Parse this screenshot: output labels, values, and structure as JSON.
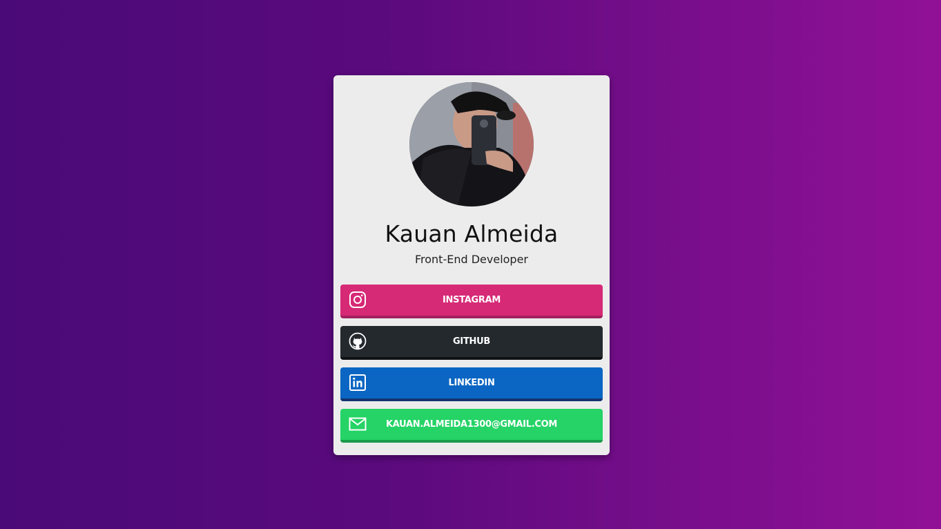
{
  "profile": {
    "name": "Kauan Almeida",
    "role": "Front-End Developer",
    "avatar_alt": "profile-photo"
  },
  "links": {
    "instagram": {
      "label": "INSTAGRAM",
      "icon": "instagram-icon",
      "color": "#d62976"
    },
    "github": {
      "label": "GITHUB",
      "icon": "github-icon",
      "color": "#24292e"
    },
    "linkedin": {
      "label": "LINKEDIN",
      "icon": "linkedin-icon",
      "color": "#0a66c2"
    },
    "email": {
      "label": "KAUAN.ALMEIDA1300@GMAIL.COM",
      "icon": "mail-icon",
      "color": "#25d366"
    }
  },
  "theme": {
    "background_start": "#4a0a78",
    "background_end": "#911196",
    "card": "#ececec"
  }
}
